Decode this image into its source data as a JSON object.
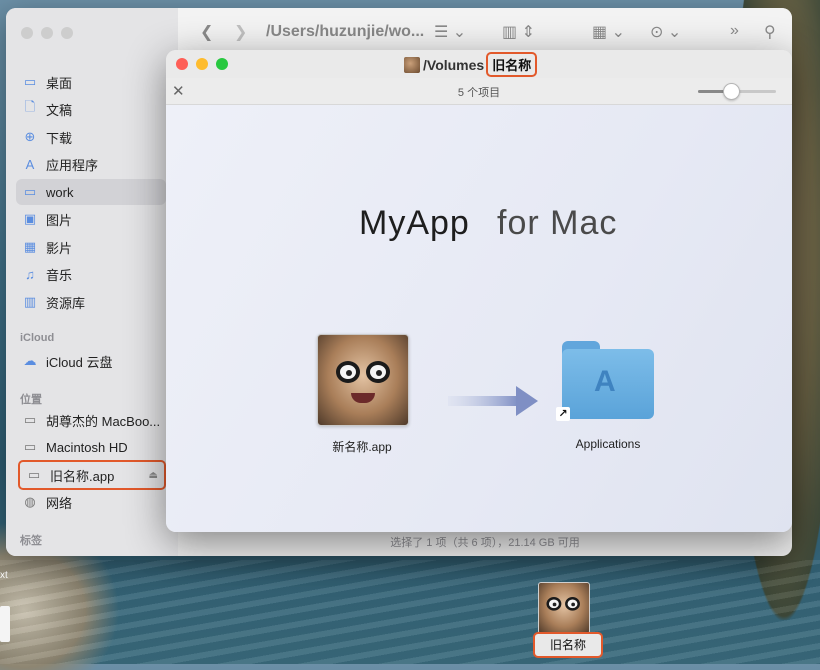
{
  "desktop": {
    "ext_text": "xt",
    "volume_label": "旧名称"
  },
  "finder": {
    "path": "/Users/huzunjie/wo...",
    "sidebar": {
      "items": [
        {
          "label": "桌面",
          "icon": "desktop-icon",
          "glyph": "▭"
        },
        {
          "label": "文稿",
          "icon": "document-icon",
          "glyph": "🗋"
        },
        {
          "label": "下载",
          "icon": "download-icon",
          "glyph": "⊕"
        },
        {
          "label": "应用程序",
          "icon": "apps-icon",
          "glyph": "A"
        },
        {
          "label": "work",
          "icon": "folder-icon",
          "glyph": "▭"
        },
        {
          "label": "图片",
          "icon": "photo-icon",
          "glyph": "▣"
        },
        {
          "label": "影片",
          "icon": "film-icon",
          "glyph": "▦"
        },
        {
          "label": "音乐",
          "icon": "music-icon",
          "glyph": "♫"
        },
        {
          "label": "资源库",
          "icon": "library-icon",
          "glyph": "▥"
        }
      ],
      "icloud_head": "iCloud",
      "icloud_item": "iCloud 云盘",
      "locations_head": "位置",
      "locations": [
        "胡尊杰的 MacBoo...",
        "Macintosh HD",
        "旧名称.app",
        "网络"
      ],
      "tags_head": "标签"
    },
    "status": "选择了 1 项（共 6 项），21.14 GB 可用"
  },
  "dmg": {
    "title_path": "/Volumes",
    "title_name": "旧名称",
    "item_count": "5 个项目",
    "zoom_level": 0.4,
    "brand_main": "MyApp",
    "brand_sub": "for Mac",
    "app_label": "新名称.app",
    "applications_label": "Applications",
    "colors": {
      "close": "#fe5f57",
      "minimize": "#febc2e",
      "zoom": "#28c840",
      "highlight": "#e2592b"
    }
  }
}
